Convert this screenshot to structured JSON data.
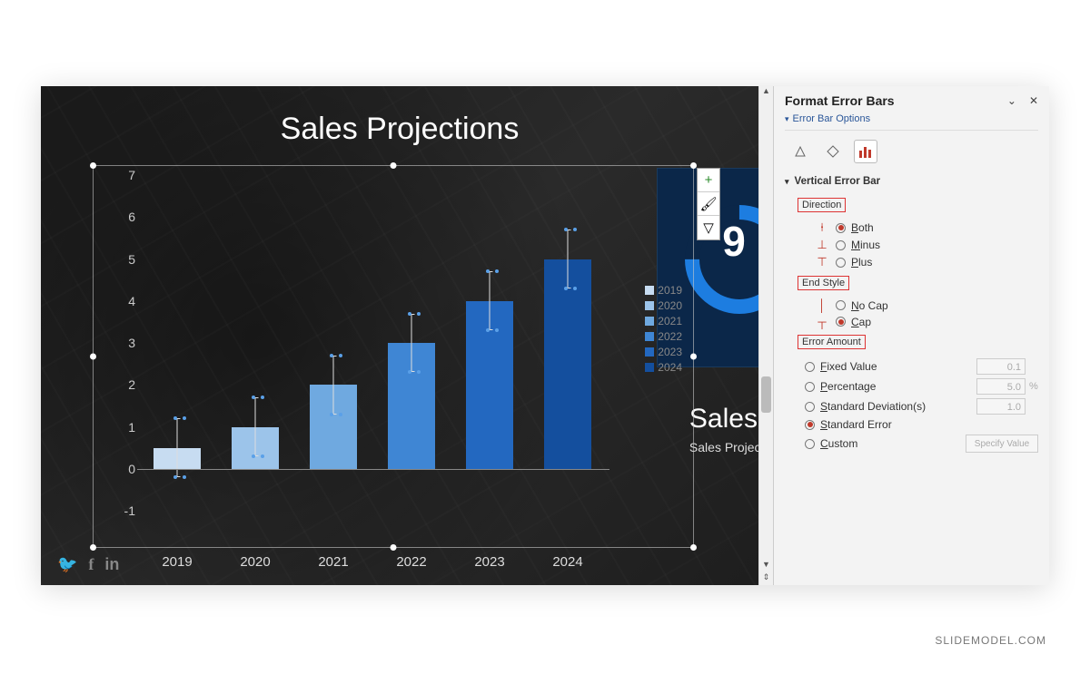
{
  "branding": "SLIDEMODEL.COM",
  "slide": {
    "title": "Sales Projections",
    "subtitle_big": "Sales Pro",
    "subtitle_small": "Sales Projection D",
    "side_number": "9",
    "social": [
      "twitter",
      "facebook",
      "linkedin"
    ]
  },
  "chart_controls": {
    "plus": "+",
    "brush": "🖌",
    "filter": "▽"
  },
  "chart_legend": [
    "2019",
    "2020",
    "2021",
    "2022",
    "2023",
    "2024"
  ],
  "chart_data": {
    "type": "bar",
    "title": "Sales Projections",
    "xlabel": "",
    "ylabel": "",
    "categories": [
      "2019",
      "2020",
      "2021",
      "2022",
      "2023",
      "2024"
    ],
    "values": [
      0.5,
      1,
      2,
      3,
      4,
      5
    ],
    "error": 0.7,
    "ylim": [
      -1,
      7
    ],
    "y_ticks": [
      -1,
      0,
      1,
      2,
      3,
      4,
      5,
      6,
      7
    ],
    "colors": [
      "#c7dcf1",
      "#9cc4ea",
      "#6fa9e0",
      "#3f86d4",
      "#2368c0",
      "#144f9e"
    ]
  },
  "panel": {
    "title": "Format Error Bars",
    "dropdown": "Error Bar Options",
    "icons": [
      "fill",
      "effects",
      "bars"
    ],
    "section": "Vertical Error Bar",
    "groups": {
      "direction": {
        "label": "Direction",
        "options": [
          {
            "key": "both",
            "label": "Both",
            "selected": true
          },
          {
            "key": "minus",
            "label": "Minus",
            "selected": false
          },
          {
            "key": "plus",
            "label": "Plus",
            "selected": false
          }
        ]
      },
      "end_style": {
        "label": "End Style",
        "options": [
          {
            "key": "nocap",
            "label": "No Cap",
            "selected": false
          },
          {
            "key": "cap",
            "label": "Cap",
            "selected": true
          }
        ]
      },
      "error_amount": {
        "label": "Error Amount",
        "options": [
          {
            "key": "fixed",
            "label": "Fixed Value",
            "value": "0.1",
            "selected": false
          },
          {
            "key": "percent",
            "label": "Percentage",
            "value": "5.0",
            "suffix": "%",
            "selected": false
          },
          {
            "key": "stdev",
            "label": "Standard Deviation(s)",
            "value": "1.0",
            "selected": false
          },
          {
            "key": "stderr",
            "label": "Standard Error",
            "selected": true
          },
          {
            "key": "custom",
            "label": "Custom",
            "button": "Specify Value",
            "selected": false
          }
        ]
      }
    }
  }
}
